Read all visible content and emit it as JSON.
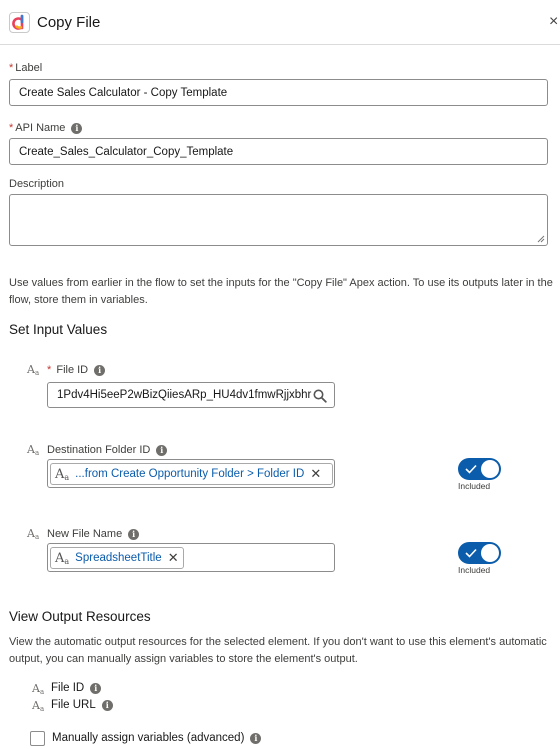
{
  "header": {
    "title": "Copy File",
    "icon": "flow-app-icon",
    "close_glyph": "×"
  },
  "form": {
    "label": {
      "label": "Label",
      "required": true,
      "value": "Create Sales Calculator - Copy Template"
    },
    "api_name": {
      "label": "API Name",
      "required": true,
      "value": "Create_Sales_Calculator_Copy_Template"
    },
    "description": {
      "label": "Description",
      "value": ""
    }
  },
  "intro": "Use values from earlier in the flow to set the inputs for the \"Copy File\" Apex action. To use its outputs later in the flow, store them in variables.",
  "set_input": {
    "title": "Set Input Values",
    "file_id": {
      "label": "File ID",
      "required": true,
      "value": "1Pdv4Hi5eeP2wBizQiiesARp_HU4dv1fmwRjjxbhr"
    },
    "destination_folder": {
      "label": "Destination Folder ID",
      "pill": "...from Create Opportunity Folder > Folder ID",
      "toggle_label": "Included"
    },
    "new_file_name": {
      "label": "New File Name",
      "pill": "SpreadsheetTitle",
      "toggle_label": "Included"
    }
  },
  "output": {
    "title": "View Output Resources",
    "description": "View the automatic output resources for the selected element. If you don't want to use this element's automatic output, you can manually assign variables to store the element's output.",
    "resources": [
      "File ID",
      "File URL"
    ],
    "manual_assign_label": "Manually assign variables (advanced)"
  },
  "glyphs": {
    "info": "i",
    "remove": "✕",
    "aa_main": "A",
    "aa_sub": "a"
  },
  "colors": {
    "accent": "#0b5cab",
    "required": "#c23934",
    "pill_text": "#0b5cab"
  }
}
